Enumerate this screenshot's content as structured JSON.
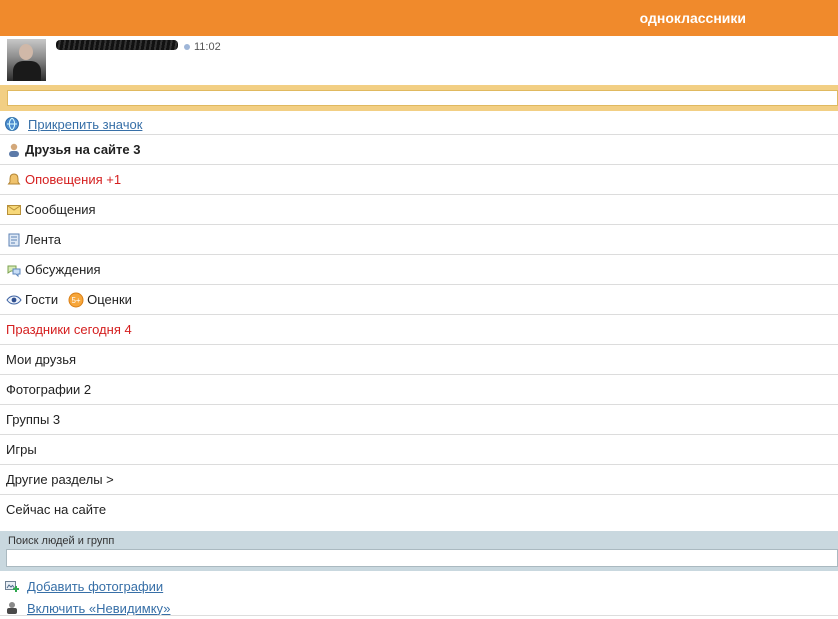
{
  "header": {
    "logo": "одноклассники"
  },
  "profile": {
    "time": "11:02"
  },
  "status": {
    "placeholder": ""
  },
  "attach_icon_label": "Прикрепить значок",
  "menu": [
    {
      "label": "Друзья на сайте 3",
      "icon": "friends-icon",
      "style": "bold"
    },
    {
      "label": "Оповещения +1",
      "icon": "bell-icon",
      "style": "red"
    },
    {
      "label": "Сообщения",
      "icon": "envelope-icon",
      "style": "normal"
    },
    {
      "label": "Лента",
      "icon": "feed-icon",
      "style": "normal"
    },
    {
      "label": "Обсуждения",
      "icon": "speech-bubbles-icon",
      "style": "normal"
    },
    {
      "guests": "Гости",
      "ratings": "Оценки",
      "icon1": "eye-icon",
      "icon2": "five-plus-icon"
    },
    {
      "label": "Праздники сегодня 4",
      "style": "red"
    },
    {
      "label": "Мои друзья",
      "style": "normal"
    },
    {
      "label": "Фотографии 2",
      "style": "normal"
    },
    {
      "label": "Группы 3",
      "style": "normal"
    },
    {
      "label": "Игры",
      "style": "normal"
    },
    {
      "label": "Другие разделы >",
      "style": "normal"
    },
    {
      "label": "Сейчас на сайте",
      "style": "normal"
    }
  ],
  "search": {
    "label": "Поиск людей и групп",
    "value": ""
  },
  "bottom": {
    "add_photos": "Добавить фотографии",
    "invisible": "Включить «Невидимку»"
  },
  "colors": {
    "header": "#f08a2c",
    "accent_red": "#d52020",
    "link": "#376fa7"
  }
}
